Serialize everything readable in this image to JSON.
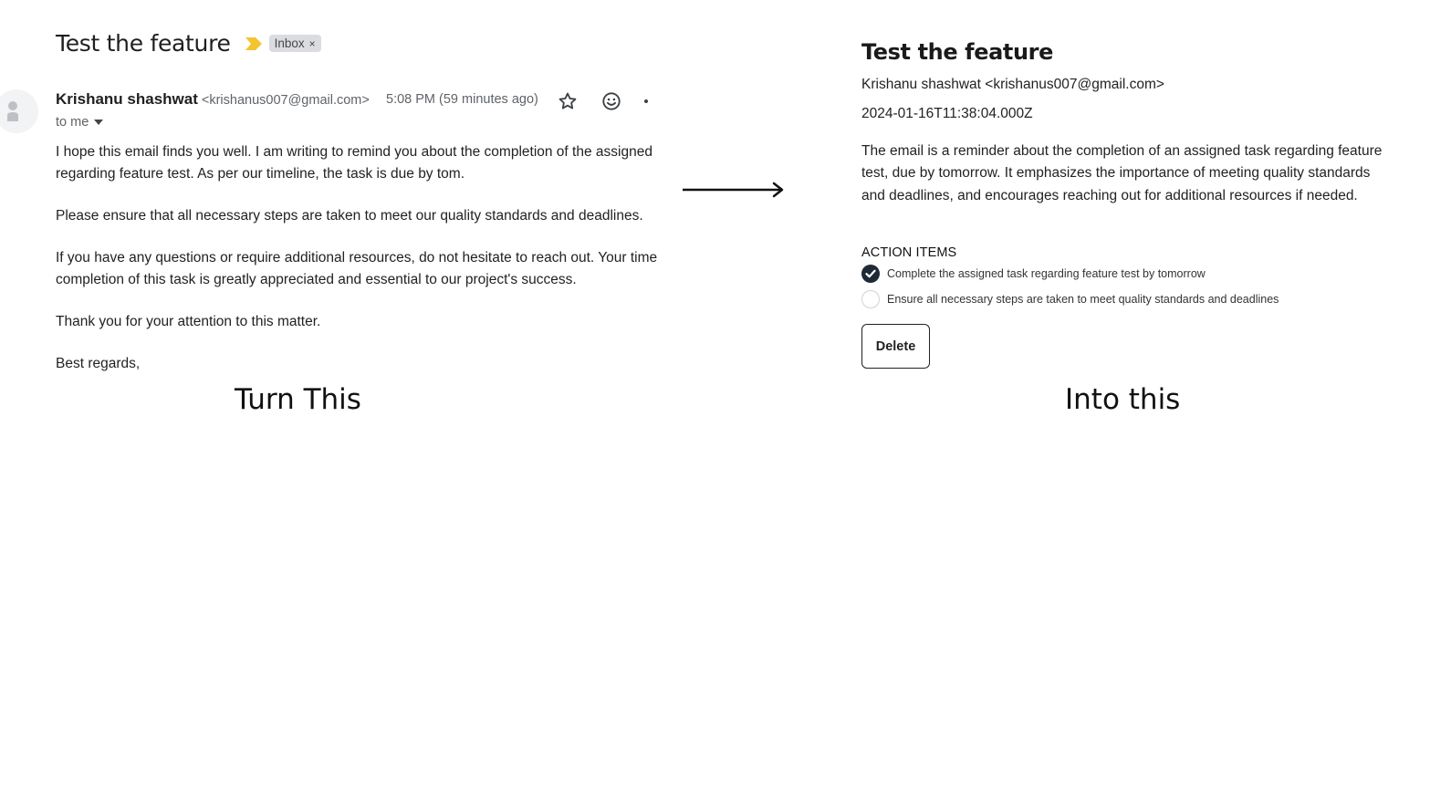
{
  "source_email": {
    "subject": "Test the feature",
    "label": "Inbox",
    "label_close": "×",
    "sender_name": "Krishanu shashwat",
    "sender_email": "<krishanus007@gmail.com>",
    "time": "5:08 PM (59 minutes ago)",
    "to": "to me",
    "body_paragraphs": [
      "I hope this email finds you well. I am writing to remind you about the completion of the assigned\nregarding feature test. As per our timeline, the task is due by tom.",
      "Please ensure that all necessary steps are taken to meet our quality standards and deadlines.",
      "If you have any questions or require additional resources, do not hesitate to reach out. Your time\ncompletion of this task is greatly appreciated and essential to our project's success.",
      "Thank you for your attention to this matter.",
      "Best regards,"
    ],
    "icons": {
      "important": "important-marker-icon",
      "star": "star-icon",
      "emoji": "emoji-icon",
      "more": "more-vert-icon",
      "avatar": "person-icon"
    },
    "colors": {
      "important": "#f4c430",
      "label_bg": "#dadce0"
    }
  },
  "captions": {
    "left": "Turn This",
    "right": "Into this"
  },
  "summary_card": {
    "title": "Test the feature",
    "from": "Krishanu shashwat <krishanus007@gmail.com>",
    "date": "2024-01-16T11:38:04.000Z",
    "summary": "The email is a reminder about the completion of an assigned task regarding feature test, due by tomorrow. It emphasizes the importance of meeting quality standards and deadlines, and encourages reaching out for additional resources if needed.",
    "action_items_title": "ACTION ITEMS",
    "action_items": [
      {
        "text": "Complete the assigned task regarding feature test by tomorrow",
        "checked": true
      },
      {
        "text": "Ensure all necessary steps are taken to meet quality standards and deadlines",
        "checked": false
      }
    ],
    "delete_label": "Delete",
    "colors": {
      "checked_fill": "#1f2a37"
    }
  }
}
